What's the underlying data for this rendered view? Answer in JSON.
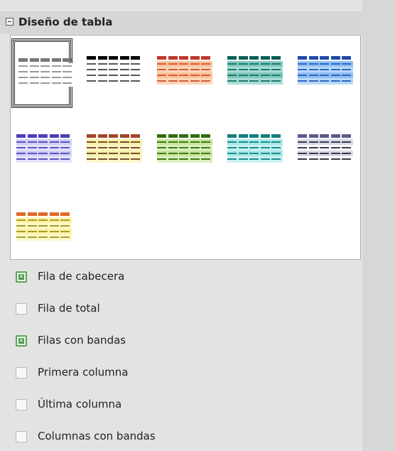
{
  "panel": {
    "title": "Diseño de tabla"
  },
  "table_styles": [
    {
      "id": "default",
      "header": "#777777",
      "body": "#9a9a9a",
      "rows_bg": [
        "#ffffff",
        "#ffffff"
      ],
      "selected": true
    },
    {
      "id": "black",
      "header": "#000000",
      "body": "#555555",
      "rows_bg": [
        "#ffffff",
        "#ffffff"
      ]
    },
    {
      "id": "red",
      "header": "#c0392b",
      "body": "#d65a3a",
      "rows_bg": [
        "#f9c29a",
        "#fbd6bb"
      ]
    },
    {
      "id": "teal-dark",
      "header": "#0b5f57",
      "body": "#1a7b71",
      "rows_bg": [
        "#7fc7bd",
        "#aadcd5"
      ]
    },
    {
      "id": "blue",
      "header": "#1f4aa8",
      "body": "#2d66c5",
      "rows_bg": [
        "#8fc0f2",
        "#b9d8f7"
      ]
    },
    {
      "id": "lavender",
      "header": "#4b3fb8",
      "body": "#5b52c4",
      "rows_bg": [
        "#cfd0f5",
        "#e4e4fa"
      ]
    },
    {
      "id": "brown-yellow",
      "header": "#a2462a",
      "body": "#7a4e2d",
      "rows_bg": [
        "#f7f0a9",
        "#fbf6c7"
      ]
    },
    {
      "id": "green",
      "header": "#2f6e10",
      "body": "#3d7a16",
      "rows_bg": [
        "#c6e49a",
        "#dcefbf"
      ]
    },
    {
      "id": "teal-light",
      "header": "#137e7d",
      "body": "#1a8d8c",
      "rows_bg": [
        "#a8e8e6",
        "#c9f1f0"
      ]
    },
    {
      "id": "gray-purple",
      "header": "#5b5a8a",
      "body": "#3a3a4a",
      "rows_bg": [
        "#d9d9ea",
        "#ffffff"
      ]
    },
    {
      "id": "yellow-orange",
      "header": "#e06a2a",
      "body": "#a0a030",
      "rows_bg": [
        "#fff2a6",
        "#fff8c9"
      ]
    }
  ],
  "options": [
    {
      "label": "Fila de cabecera",
      "checked": true
    },
    {
      "label": "Fila de total",
      "checked": false
    },
    {
      "label": "Filas con bandas",
      "checked": true
    },
    {
      "label": "Primera columna",
      "checked": false
    },
    {
      "label": "Última columna",
      "checked": false
    },
    {
      "label": "Columnas con bandas",
      "checked": false
    }
  ]
}
